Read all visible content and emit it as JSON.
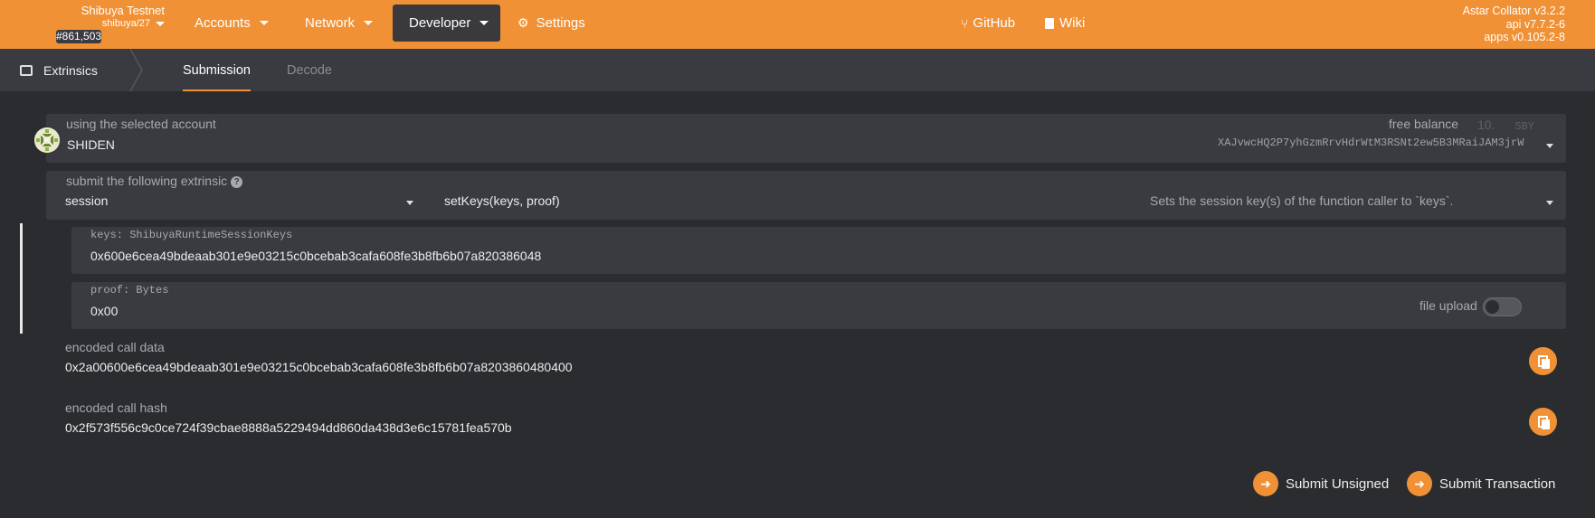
{
  "chain": {
    "name": "Shibuya Testnet",
    "spec": "shibuya/27",
    "block": "#861,503"
  },
  "nav": {
    "accounts": "Accounts",
    "network": "Network",
    "developer": "Developer",
    "settings": "Settings",
    "github": "GitHub",
    "wiki": "Wiki"
  },
  "versions": {
    "collator": "Astar Collator v3.2.2",
    "api": "api v7.7.2-6",
    "apps": "apps v0.105.2-8"
  },
  "subnav": {
    "title": "Extrinsics",
    "tabs": [
      "Submission",
      "Decode"
    ]
  },
  "account": {
    "label": "using the selected account",
    "name": "SHIDEN",
    "balance_label": "free balance",
    "balance_value": "10.",
    "balance_unit": "SBY",
    "address": "XAJvwcHQ2P7yhGzmRrvHdrWtM3RSNt2ew5B3MRaiJAM3jrW"
  },
  "extrinsic": {
    "label": "submit the following extrinsic",
    "pallet": "session",
    "method": "setKeys(keys, proof)",
    "description": "Sets the session key(s) of the function caller to `keys`."
  },
  "params": {
    "keys_label": "keys: ShibuyaRuntimeSessionKeys",
    "keys_value": "0x600e6cea49bdeaab301e9e03215c0bcebab3cafa608fe3b8fb6b07a820386048",
    "proof_label": "proof: Bytes",
    "proof_value": "0x00",
    "file_upload": "file upload"
  },
  "encoded": {
    "data_label": "encoded call data",
    "data_value": "0x2a00600e6cea49bdeaab301e9e03215c0bcebab3cafa608fe3b8fb6b07a8203860480400",
    "hash_label": "encoded call hash",
    "hash_value": "0x2f573f556c9c0ce724f39cbae8888a5229494dd860da438d3e6c15781fea570b"
  },
  "actions": {
    "unsigned": "Submit Unsigned",
    "transaction": "Submit Transaction"
  },
  "colors": {
    "accent": "#f19135",
    "background": "#2b2c30",
    "panel": "#3a3b40"
  }
}
